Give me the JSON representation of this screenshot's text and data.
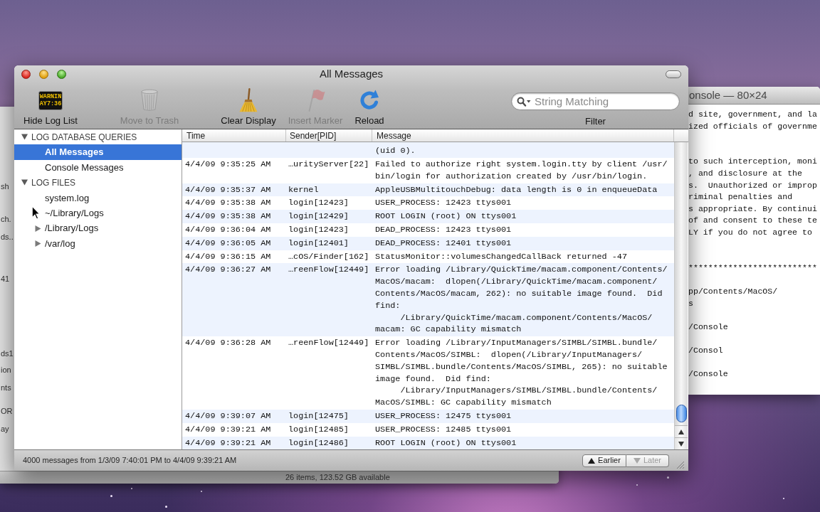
{
  "finder_window": {
    "edge_texts": [
      "sh",
      "ch.",
      "ds..",
      "41",
      "ds1",
      "ion",
      "nts",
      "OR",
      "ay"
    ],
    "status": "26 items, 123.52 GB available"
  },
  "terminal_window": {
    "title": "onsole — 80×24",
    "text": "d site, government, and la\nized officials of governme\n\n\nto such interception, moni\n, and disclosure at the\ns.  Unauthorized or improp\nriminal penalties and\ns appropriate. By continui\nof and consent to these te\nLY if you do not agree to\n\n\n**************************\n\npp/Contents/MacOS/\ns\n\n/Console\n\n/Consol\n\n/Console"
  },
  "window": {
    "title": "All Messages"
  },
  "toolbar": {
    "items": [
      {
        "kind": "log_list",
        "label": "Hide Log List",
        "disabled": false,
        "icon_text": [
          "WARNIN",
          "AY7:36"
        ]
      },
      {
        "kind": "trash",
        "label": "Move to Trash",
        "disabled": true
      },
      {
        "kind": "broom",
        "label": "Clear Display",
        "disabled": false
      },
      {
        "kind": "marker",
        "label": "Insert Marker",
        "disabled": true
      },
      {
        "kind": "reload",
        "label": "Reload",
        "disabled": false
      }
    ],
    "filter": {
      "placeholder": "String Matching",
      "label": "Filter"
    }
  },
  "sidebar": {
    "groups": [
      {
        "label": "LOG DATABASE QUERIES",
        "expanded": true,
        "items": [
          {
            "label": "All Messages",
            "selected": true
          },
          {
            "label": "Console Messages",
            "selected": false
          }
        ]
      },
      {
        "label": "LOG FILES",
        "expanded": true,
        "items": [
          {
            "label": "system.log",
            "selected": false
          },
          {
            "label": "~/Library/Logs",
            "selected": false
          },
          {
            "label": "/Library/Logs",
            "selected": false,
            "expanded": false
          },
          {
            "label": "/var/log",
            "selected": false,
            "expanded": false
          }
        ]
      }
    ]
  },
  "table": {
    "columns": [
      "Time",
      "Sender[PID]",
      "Message"
    ],
    "rows": [
      {
        "message": "(uid 0)."
      },
      {
        "time": "4/4/09 9:35:25 AM",
        "sender": "…urityServer[22]",
        "message": "Failed to authorize right system.login.tty by client /usr/\nbin/login for authorization created by /usr/bin/login."
      },
      {
        "time": "4/4/09 9:35:37 AM",
        "sender": "kernel",
        "message": "AppleUSBMultitouchDebug: data length is 0 in enqueueData"
      },
      {
        "time": "4/4/09 9:35:38 AM",
        "sender": "login[12423]",
        "message": "USER_PROCESS: 12423 ttys001"
      },
      {
        "time": "4/4/09 9:35:38 AM",
        "sender": "login[12429]",
        "message": "ROOT LOGIN (root) ON ttys001"
      },
      {
        "time": "4/4/09 9:36:04 AM",
        "sender": "login[12423]",
        "message": "DEAD_PROCESS: 12423 ttys001"
      },
      {
        "time": "4/4/09 9:36:05 AM",
        "sender": "login[12401]",
        "message": "DEAD_PROCESS: 12401 ttys001"
      },
      {
        "time": "4/4/09 9:36:15 AM",
        "sender": "…cOS/Finder[162]",
        "message": "StatusMonitor::volumesChangedCallBack returned -47"
      },
      {
        "time": "4/4/09 9:36:27 AM",
        "sender": "…reenFlow[12449]",
        "message": "Error loading /Library/QuickTime/macam.component/Contents/\nMacOS/macam:  dlopen(/Library/QuickTime/macam.component/\nContents/MacOS/macam, 262): no suitable image found.  Did\nfind:\n\t/Library/QuickTime/macam.component/Contents/MacOS/\nmacam: GC capability mismatch"
      },
      {
        "time": "4/4/09 9:36:28 AM",
        "sender": "…reenFlow[12449]",
        "message": "Error loading /Library/InputManagers/SIMBL/SIMBL.bundle/\nContents/MacOS/SIMBL:  dlopen(/Library/InputManagers/\nSIMBL/SIMBL.bundle/Contents/MacOS/SIMBL, 265): no suitable\nimage found.  Did find:\n\t/Library/InputManagers/SIMBL/SIMBL.bundle/Contents/\nMacOS/SIMBL: GC capability mismatch"
      },
      {
        "time": "4/4/09 9:39:07 AM",
        "sender": "login[12475]",
        "message": "USER_PROCESS: 12475 ttys001"
      },
      {
        "time": "4/4/09 9:39:21 AM",
        "sender": "login[12485]",
        "message": "USER_PROCESS: 12485 ttys001"
      },
      {
        "time": "4/4/09 9:39:21 AM",
        "sender": "login[12486]",
        "message": "ROOT LOGIN (root) ON ttys001"
      }
    ]
  },
  "status_bar": {
    "summary": "4000 messages from 1/3/09 7:40:01 PM to 4/4/09 9:39:21 AM",
    "buttons": [
      {
        "kind": "earlier",
        "label": "Earlier",
        "disabled": false
      },
      {
        "kind": "later",
        "label": "Later",
        "disabled": true
      }
    ]
  }
}
